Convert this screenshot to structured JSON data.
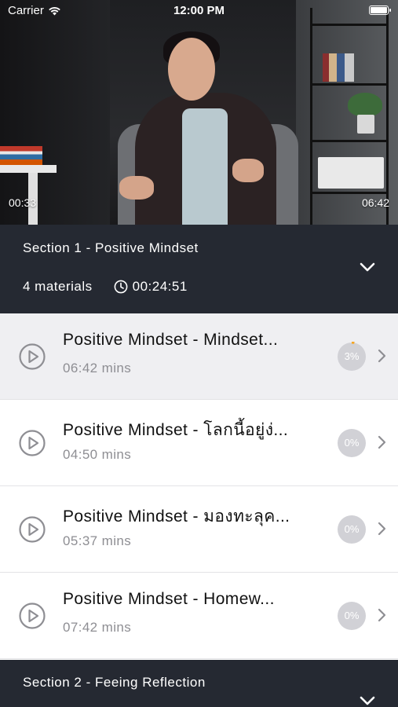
{
  "status_bar": {
    "carrier": "Carrier",
    "time": "12:00 PM",
    "icons": [
      "wifi-icon",
      "battery-icon"
    ]
  },
  "video": {
    "elapsed": "00:33",
    "duration": "06:42"
  },
  "sections": [
    {
      "title": "Section 1 - Positive Mindset",
      "materials": "4 materials",
      "total_time": "00:24:51",
      "expanded": true
    },
    {
      "title": "Section 2 - Feeing Reflection",
      "expanded": false
    }
  ],
  "lessons": [
    {
      "title": "Positive Mindset - Mindset...",
      "duration": "06:42 mins",
      "progress_label": "3%",
      "progress": 3,
      "active": true
    },
    {
      "title": "Positive Mindset - โลกนี้อยู่ง่...",
      "duration": "04:50 mins",
      "progress_label": "0%",
      "progress": 0,
      "active": false
    },
    {
      "title": "Positive Mindset - มองทะลุค...",
      "duration": "05:37 mins",
      "progress_label": "0%",
      "progress": 0,
      "active": false
    },
    {
      "title": "Positive Mindset -  Homew...",
      "duration": "07:42 mins",
      "progress_label": "0%",
      "progress": 0,
      "active": false
    }
  ],
  "colors": {
    "header_bg": "#252932",
    "active_row_bg": "#efeff2",
    "progress_circle": "#d1d1d6",
    "progress_accent": "#f5a623",
    "muted_text": "#8e8e93"
  }
}
